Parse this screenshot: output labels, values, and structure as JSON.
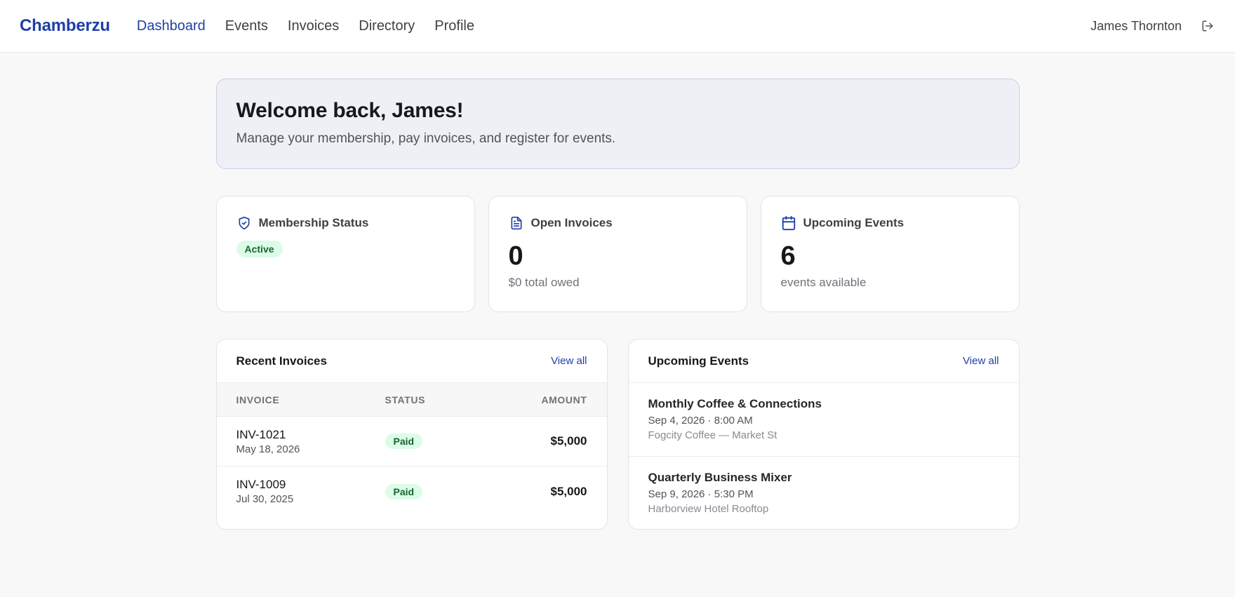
{
  "header": {
    "brand": "Chamberzu",
    "nav": [
      {
        "label": "Dashboard",
        "active": true
      },
      {
        "label": "Events",
        "active": false
      },
      {
        "label": "Invoices",
        "active": false
      },
      {
        "label": "Directory",
        "active": false
      },
      {
        "label": "Profile",
        "active": false
      }
    ],
    "user_name": "James Thornton",
    "logout_icon": "logout-icon"
  },
  "welcome": {
    "title": "Welcome back, James!",
    "subtitle": "Manage your membership, pay invoices, and register for events."
  },
  "stats": {
    "membership": {
      "title": "Membership Status",
      "icon": "shield-check-icon",
      "badge": "Active"
    },
    "invoices": {
      "title": "Open Invoices",
      "icon": "document-icon",
      "value": "0",
      "sub": "$0 total owed"
    },
    "events": {
      "title": "Upcoming Events",
      "icon": "calendar-icon",
      "value": "6",
      "sub": "events available"
    }
  },
  "recent_invoices": {
    "title": "Recent Invoices",
    "view_all": "View all",
    "columns": [
      "INVOICE",
      "STATUS",
      "AMOUNT"
    ],
    "rows": [
      {
        "number": "INV-1021",
        "date": "May 18, 2026",
        "status": "Paid",
        "amount": "$5,000"
      },
      {
        "number": "INV-1009",
        "date": "Jul 30, 2025",
        "status": "Paid",
        "amount": "$5,000"
      }
    ]
  },
  "upcoming_events": {
    "title": "Upcoming Events",
    "view_all": "View all",
    "items": [
      {
        "name": "Monthly Coffee & Connections",
        "when": "Sep 4, 2026 · 8:00 AM",
        "where": "Fogcity Coffee — Market St"
      },
      {
        "name": "Quarterly Business Mixer",
        "when": "Sep 9, 2026 · 5:30 PM",
        "where": "Harborview Hotel Rooftop"
      }
    ]
  },
  "colors": {
    "brand": "#1e3fa8",
    "success_bg": "#dcfce7",
    "success_text": "#166534"
  }
}
